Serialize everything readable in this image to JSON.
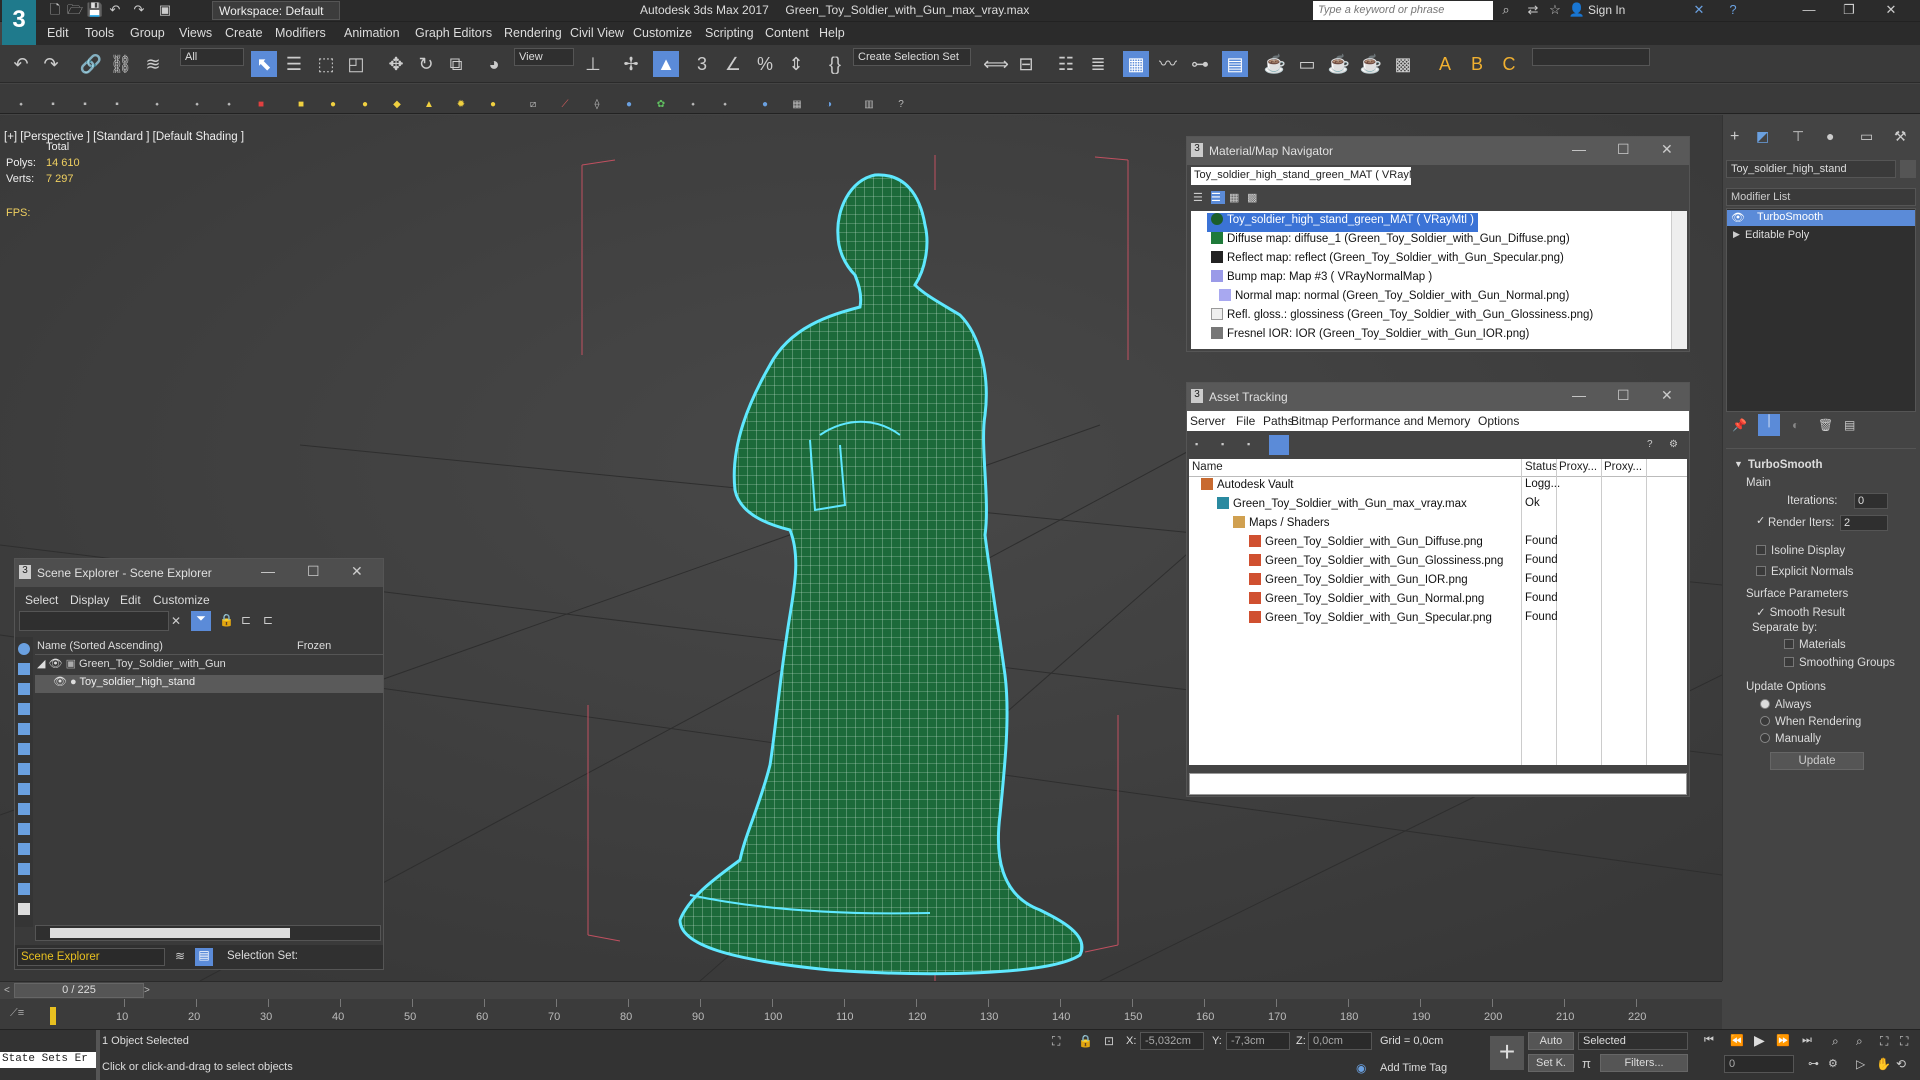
{
  "app": {
    "logo": "3",
    "workspace": "Workspace: Default",
    "title": "Autodesk 3ds Max 2017",
    "file": "Green_Toy_Soldier_with_Gun_max_vray.max",
    "search_placeholder": "Type a keyword or phrase",
    "signin": "Sign In"
  },
  "menu": [
    "Edit",
    "Tools",
    "Group",
    "Views",
    "Create",
    "Modifiers",
    "Animation",
    "Graph Editors",
    "Rendering",
    "Civil View",
    "Customize",
    "Scripting",
    "Content",
    "Help"
  ],
  "toolbar": {
    "filter": "All",
    "view": "View",
    "selection_set": "Create Selection Set"
  },
  "viewport": {
    "label": "[+] [Perspective ] [Standard ] [Default Shading ]",
    "total": "Total",
    "polys_label": "Polys:",
    "polys": "14 610",
    "verts_label": "Verts:",
    "verts": "7 297",
    "fps": "FPS:"
  },
  "mat_nav": {
    "title": "Material/Map Navigator",
    "field": "Toy_soldier_high_stand_green_MAT  ( VRayMtl )",
    "items": [
      "Toy_soldier_high_stand_green_MAT  ( VRayMtl )",
      "Diffuse map: diffuse_1 (Green_Toy_Soldier_with_Gun_Diffuse.png)",
      "Reflect map: reflect (Green_Toy_Soldier_with_Gun_Specular.png)",
      "Bump map: Map #3  ( VRayNormalMap )",
      "Normal map: normal (Green_Toy_Soldier_with_Gun_Normal.png)",
      "Refl. gloss.: glossiness (Green_Toy_Soldier_with_Gun_Glossiness.png)",
      "Fresnel IOR: IOR (Green_Toy_Soldier_with_Gun_IOR.png)"
    ]
  },
  "asset": {
    "title": "Asset Tracking",
    "menu": [
      "Server",
      "File",
      "Paths",
      "Bitmap Performance and Memory",
      "Options"
    ],
    "cols": [
      "Name",
      "Status",
      "Proxy...",
      "Proxy..."
    ],
    "rows": [
      {
        "name": "Autodesk Vault",
        "status": "Logg..."
      },
      {
        "name": "Green_Toy_Soldier_with_Gun_max_vray.max",
        "status": "Ok"
      },
      {
        "name": "Maps / Shaders",
        "status": ""
      },
      {
        "name": "Green_Toy_Soldier_with_Gun_Diffuse.png",
        "status": "Found"
      },
      {
        "name": "Green_Toy_Soldier_with_Gun_Glossiness.png",
        "status": "Found"
      },
      {
        "name": "Green_Toy_Soldier_with_Gun_IOR.png",
        "status": "Found"
      },
      {
        "name": "Green_Toy_Soldier_with_Gun_Normal.png",
        "status": "Found"
      },
      {
        "name": "Green_Toy_Soldier_with_Gun_Specular.png",
        "status": "Found"
      }
    ]
  },
  "scene": {
    "title": "Scene Explorer - Scene Explorer",
    "menu": [
      "Select",
      "Display",
      "Edit",
      "Customize"
    ],
    "col_name": "Name (Sorted Ascending)",
    "col_frozen": "Frozen",
    "items": [
      "Green_Toy_Soldier_with_Gun",
      "Toy_soldier_high_stand"
    ],
    "footer": "Scene Explorer",
    "selection_set": "Selection Set:"
  },
  "rp": {
    "object": "Toy_soldier_high_stand",
    "modlist": "Modifier List",
    "stack": [
      "TurboSmooth",
      "Editable Poly"
    ],
    "rollout": "TurboSmooth",
    "main": "Main",
    "iterations_label": "Iterations:",
    "iterations": "0",
    "render_iters_label": "Render Iters:",
    "render_iters": "2",
    "isoline": "Isoline Display",
    "explicit": "Explicit Normals",
    "surface": "Surface Parameters",
    "smooth": "Smooth Result",
    "separate": "Separate by:",
    "materials": "Materials",
    "smoothing": "Smoothing Groups",
    "update_opts": "Update Options",
    "always": "Always",
    "when_rendering": "When Rendering",
    "manually": "Manually",
    "update_btn": "Update"
  },
  "timeline": {
    "frame": "0 / 225",
    "ticks": [
      "10",
      "20",
      "30",
      "40",
      "50",
      "60",
      "70",
      "80",
      "90",
      "100",
      "110",
      "120",
      "130",
      "140",
      "150",
      "160",
      "170",
      "180",
      "190",
      "200",
      "210",
      "220"
    ]
  },
  "status": {
    "state_sets": "State Sets Er",
    "selected": "1 Object Selected",
    "hint": "Click or click-and-drag to select objects",
    "x_label": "X:",
    "x": "-5,032cm",
    "y_label": "Y:",
    "y": "-7,3cm",
    "z_label": "Z:",
    "z": "0,0cm",
    "grid": "Grid = 0,0cm",
    "add_time_tag": "Add Time Tag",
    "auto": "Auto",
    "setk": "Set K.",
    "selected_dd": "Selected",
    "filters": "Filters...",
    "frame_field": "0"
  }
}
